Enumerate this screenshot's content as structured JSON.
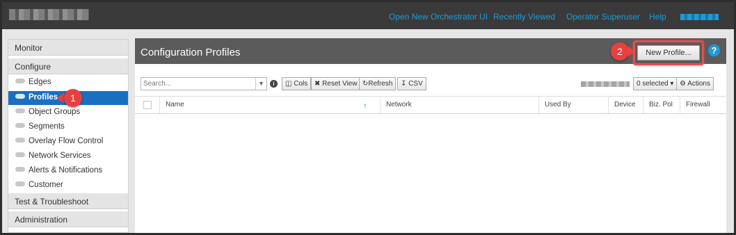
{
  "topnav": {
    "links": [
      "Open New Orchestrator UI",
      "Recently Viewed",
      "Operator Superuser",
      "Help"
    ]
  },
  "sidebar": {
    "sections": [
      "Monitor",
      "Configure",
      "Test & Troubleshoot",
      "Administration"
    ],
    "items": [
      {
        "label": "Edges"
      },
      {
        "label": "Profiles",
        "active": true
      },
      {
        "label": "Object Groups"
      },
      {
        "label": "Segments"
      },
      {
        "label": "Overlay Flow Control"
      },
      {
        "label": "Network Services"
      },
      {
        "label": "Alerts & Notifications"
      },
      {
        "label": "Customer"
      }
    ]
  },
  "main": {
    "title": "Configuration Profiles",
    "new_profile_label": "New Profile...",
    "help_glyph": "?"
  },
  "toolbar": {
    "search_placeholder": "Search...",
    "cols_label": "Cols",
    "reset_view_label": "Reset View",
    "refresh_label": "Refresh",
    "csv_label": "CSV",
    "selected_label": "0 selected",
    "actions_label": "Actions"
  },
  "table": {
    "columns": [
      "Name",
      "Network",
      "Used By",
      "Device",
      "Biz. Pol",
      "Firewall"
    ]
  },
  "annotations": {
    "badge_1": "1",
    "badge_2": "2"
  },
  "colors": {
    "accent": "#1e9bd7",
    "active_item": "#1b6fc1",
    "badge": "#e84040",
    "header_bar": "#5b5b5b"
  },
  "icons": [
    "cloud-icon",
    "info-icon",
    "columns-icon",
    "close-icon",
    "refresh-icon",
    "download-icon",
    "gear-icon",
    "help-icon",
    "sort-up-icon"
  ]
}
